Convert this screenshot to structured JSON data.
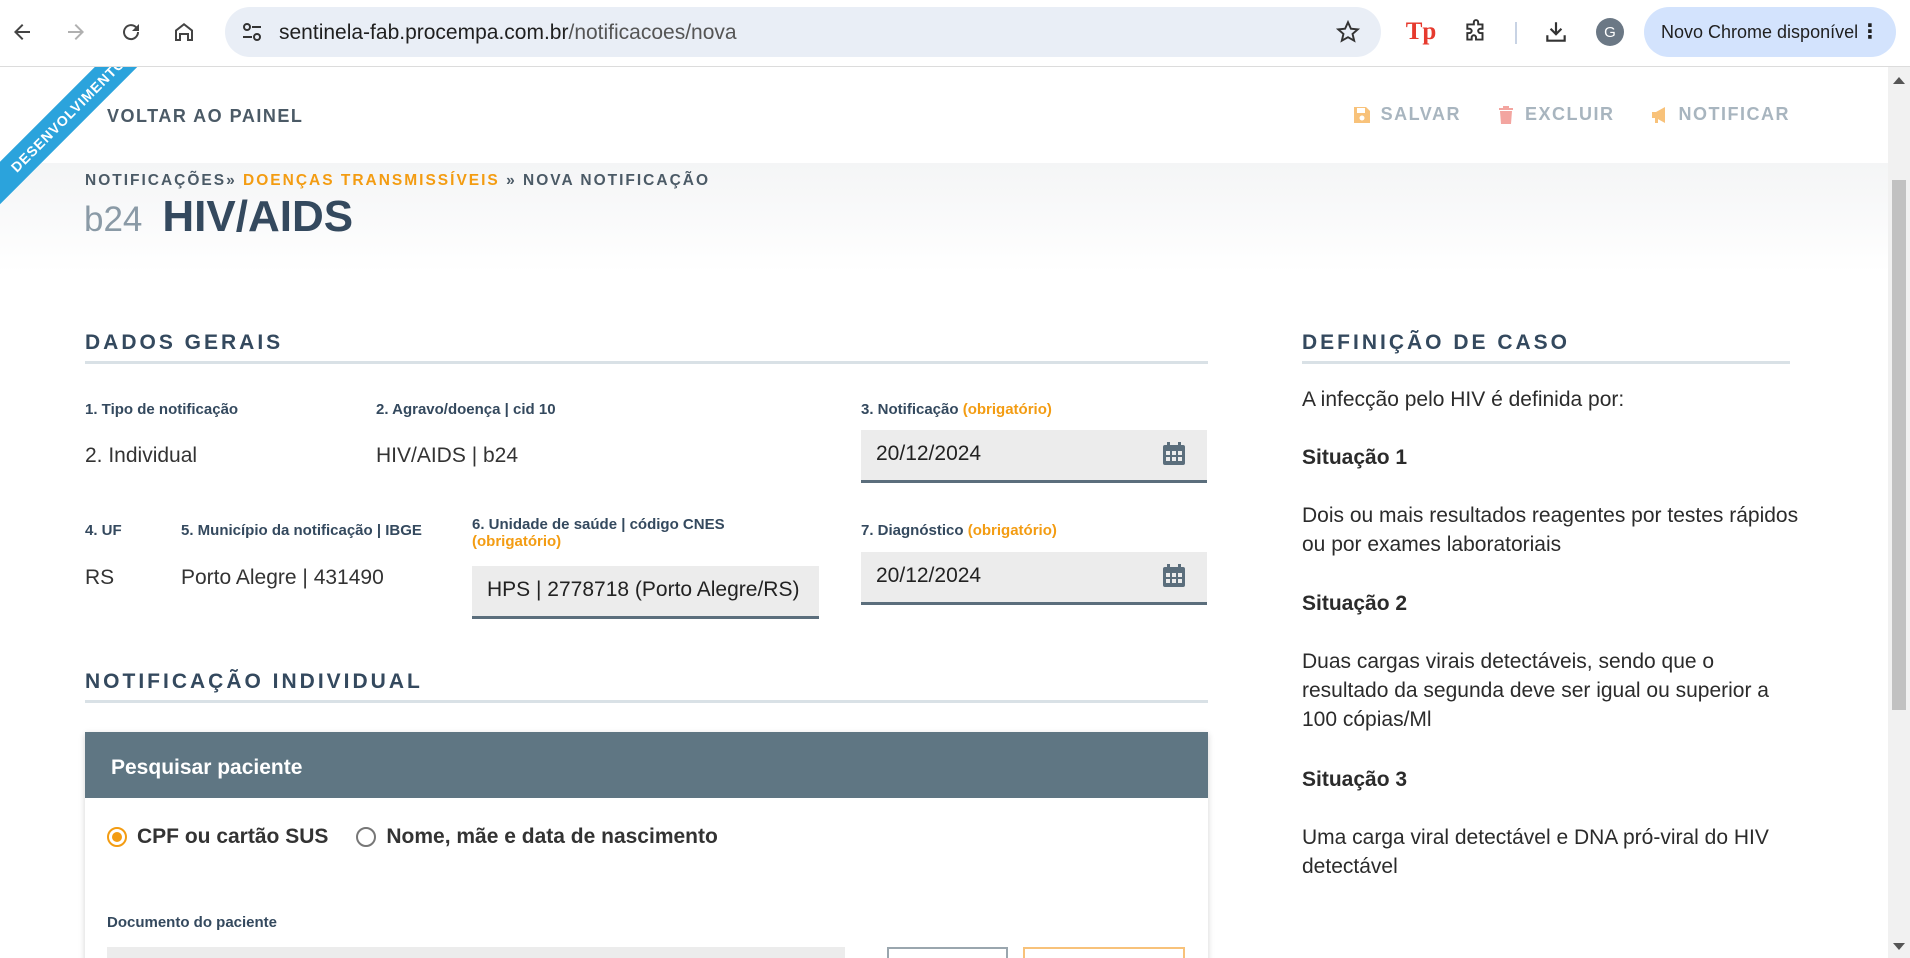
{
  "browser": {
    "url_host": "sentinela-fab.procempa.com.br",
    "url_path": "/notificacoes/nova",
    "extension_logo": "Tp",
    "profile_initial": "G",
    "update_label": "Novo Chrome disponível",
    "icons": [
      "back-arrow-icon",
      "forward-arrow-icon",
      "reload-icon",
      "home-icon",
      "site-settings-icon",
      "star-icon",
      "extensions-icon",
      "download-icon",
      "more-vert-icon"
    ]
  },
  "ribbon": {
    "label": "DESENVOLVIMENTO",
    "color": "#2ba3dc"
  },
  "topbar": {
    "back_label": "VOLTAR AO PAINEL",
    "save_label": "SALVAR",
    "delete_label": "EXCLUIR",
    "notify_label": "NOTIFICAR"
  },
  "breadcrumb": {
    "first": "NOTIFICAÇÕES»",
    "middle": "DOENÇAS TRANSMISSÍVEIS",
    "last": "» NOVA NOTIFICAÇÃO"
  },
  "title": {
    "cid": "b24",
    "disease": "HIV/AIDS"
  },
  "dados_gerais": {
    "heading": "DADOS GERAIS",
    "tipo_label": "1. Tipo de notificação",
    "tipo_value": "2. Individual",
    "agravo_label": "2. Agravo/doença | cid 10",
    "agravo_value": "HIV/AIDS | b24",
    "notificacao_label": "3. Notificação",
    "notificacao_req": "(obrigatório)",
    "notificacao_value": "20/12/2024",
    "uf_label": "4. UF",
    "uf_value": "RS",
    "municipio_label": "5. Município da notificação | IBGE",
    "municipio_value": "Porto Alegre | 431490",
    "unidade_label": "6. Unidade de saúde | código CNES",
    "unidade_req": "(obrigatório)",
    "unidade_value": "HPS | 2778718  (Porto Alegre/RS)",
    "diagnostico_label": "7. Diagnóstico",
    "diagnostico_req": "(obrigatório)",
    "diagnostico_value": "20/12/2024"
  },
  "notificacao_individual": {
    "heading": "NOTIFICAÇÃO INDIVIDUAL",
    "panel_title": "Pesquisar paciente",
    "radio_cpf": "CPF ou cartão SUS",
    "radio_nome": "Nome, mãe e data de nascimento",
    "selected": "CPF ou cartão SUS",
    "doc_label": "Documento do paciente"
  },
  "definicao": {
    "heading": "DEFINIÇÃO DE CASO",
    "intro": "A infecção pelo HIV é definida por:",
    "s1_title": "Situação 1",
    "s1_text": "Dois ou mais resultados reagentes por testes rápidos ou por exames laboratoriais",
    "s2_title": "Situação 2",
    "s2_text": "Duas cargas virais detectáveis, sendo que o resultado da segunda deve ser igual ou superior a 100 cópias/Ml",
    "s3_title": "Situação 3",
    "s3_text": "Uma carga viral detectável e DNA pró-viral do HIV detectável"
  },
  "colors": {
    "accent": "#f39c12",
    "heading": "#34495e",
    "panel_header": "#5f7683"
  }
}
